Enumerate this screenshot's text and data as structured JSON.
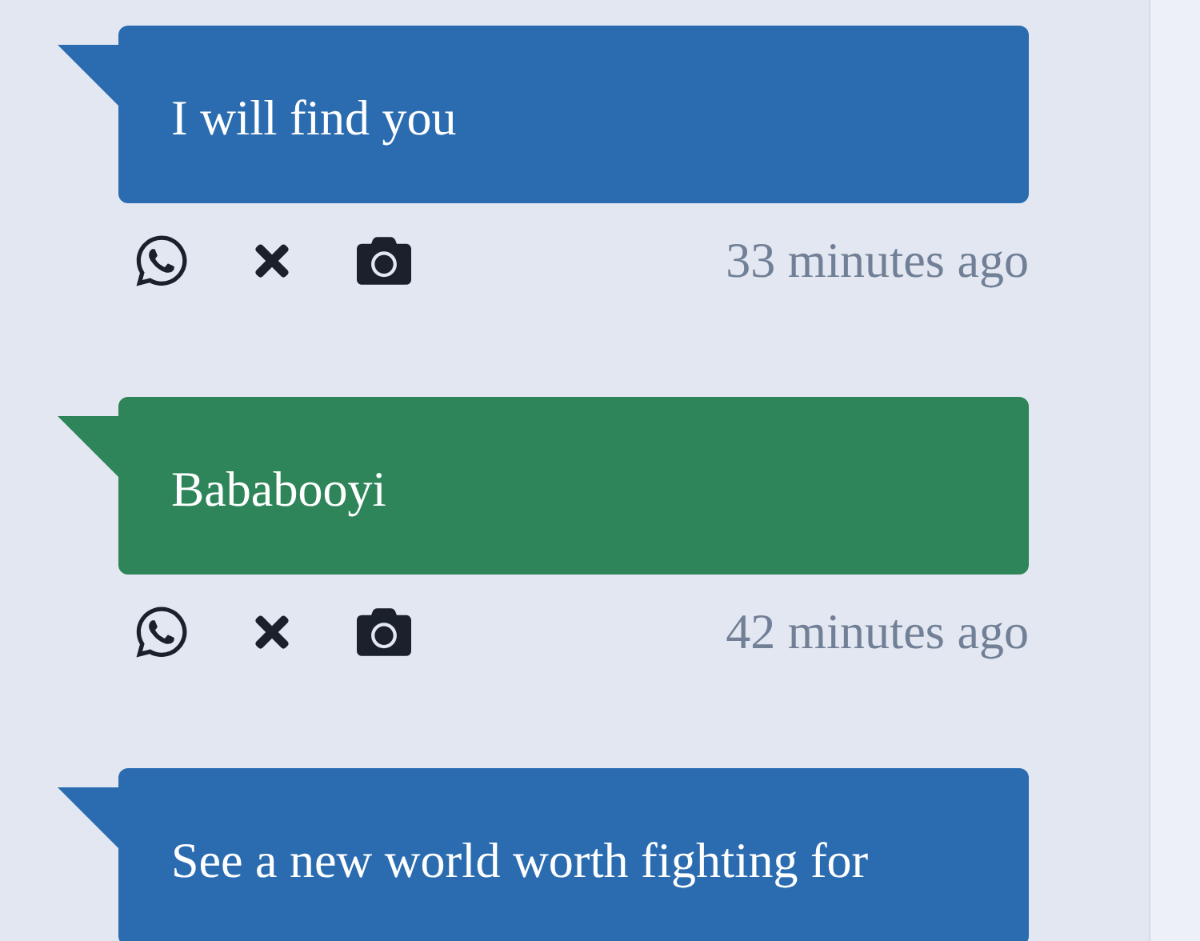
{
  "messages": [
    {
      "text": "I will find you",
      "color": "#2b6cb0",
      "time": "33 minutes ago"
    },
    {
      "text": "Bababooyi",
      "color": "#2f855a",
      "time": "42 minutes ago"
    },
    {
      "text": "See a new world worth fighting for",
      "color": "#2b6cb0"
    }
  ]
}
